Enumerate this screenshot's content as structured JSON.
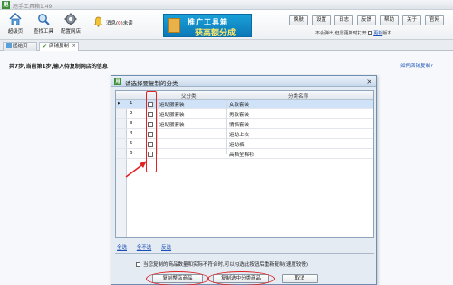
{
  "app": {
    "title": "甩手工具箱1.49",
    "icon_label": "甩"
  },
  "toolbar": {
    "tools": [
      {
        "label": "超级页",
        "icon": "home-icon"
      },
      {
        "label": "查找工具",
        "icon": "magnifier-icon"
      },
      {
        "label": "配置网店",
        "icon": "gear-icon"
      }
    ],
    "message": {
      "prefix": "消息(",
      "count": "0",
      "suffix": ")未读",
      "icon": "bell-icon"
    },
    "banner": {
      "line1": "推广工具箱",
      "line2": "获高额分成"
    },
    "buttons": [
      "换肤",
      "设置",
      "日志",
      "反馈",
      "帮助",
      "关于",
      "官网"
    ],
    "auto_close_text": "不会弹出,但需更新时打开",
    "auto_close_link": "更新",
    "auto_close_suffix": "版本"
  },
  "tabs": [
    {
      "label": "起始页",
      "icon": "home-icon",
      "active": false
    },
    {
      "label": "店铺复制",
      "icon": "check-icon",
      "active": true
    }
  ],
  "content": {
    "step_text": "共7步,当前第1步,输入待复制网店的信息",
    "howto_link": "如何店铺复制?"
  },
  "dialog": {
    "title": "请选择要复制的分类",
    "icon_label": "甩",
    "columns": {
      "parent": "父分类",
      "name": "分类名称"
    },
    "rows": [
      {
        "num": "1",
        "parent": "运动服套装",
        "name": "女款套装",
        "selected": true,
        "current": true
      },
      {
        "num": "2",
        "parent": "运动服套装",
        "name": "男款套装",
        "selected": false,
        "current": false
      },
      {
        "num": "3",
        "parent": "运动服套装",
        "name": "情侣套装",
        "selected": false,
        "current": false
      },
      {
        "num": "4",
        "parent": "",
        "name": "运动上衣",
        "selected": false,
        "current": false
      },
      {
        "num": "5",
        "parent": "",
        "name": "运动裤",
        "selected": false,
        "current": false
      },
      {
        "num": "6",
        "parent": "",
        "name": "高档全棉衫",
        "selected": false,
        "current": false
      }
    ],
    "links": [
      "全选",
      "全不选",
      "反选"
    ],
    "notice": "当您复制的商品数量和实际不符合时,可以勾选此按钮后重新复制(速度较慢)",
    "buttons": {
      "copy_all": "复制整店商品",
      "copy_selected": "复制选中分类商品",
      "cancel": "取消"
    }
  },
  "colors": {
    "accent": "#1aa0d8",
    "highlight_red": "#e02222",
    "selected_row": "#cfe2f8"
  }
}
